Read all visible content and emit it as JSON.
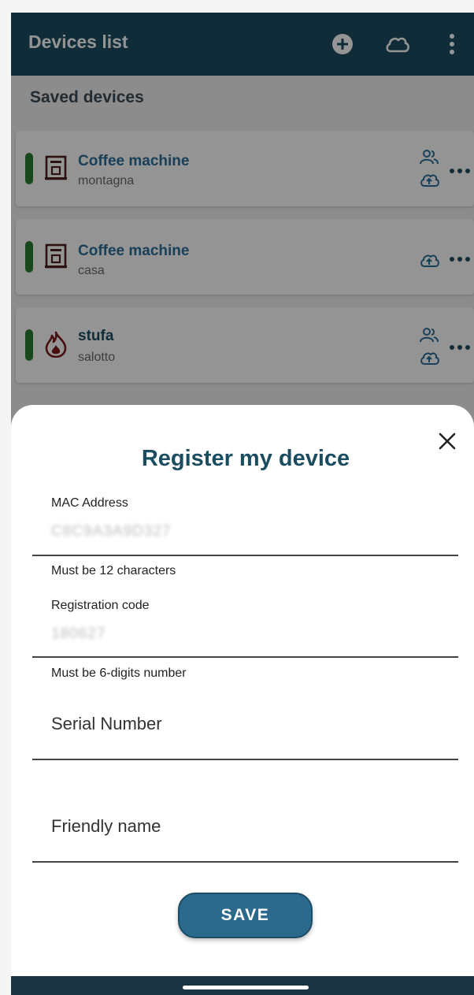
{
  "appbar": {
    "title": "Devices list",
    "icons": [
      "add-circle-icon",
      "cloud-icon",
      "more-vert-icon"
    ]
  },
  "saved_devices": {
    "heading": "Saved devices",
    "items": [
      {
        "name": "Coffee machine",
        "location": "montagna",
        "status_color": "#2e7d32",
        "device_icon": "coffee-machine-icon",
        "actions": [
          "users-icon",
          "cloud-upload-icon"
        ]
      },
      {
        "name": "Coffee machine",
        "location": "casa",
        "status_color": "#2e7d32",
        "device_icon": "coffee-machine-icon",
        "actions": [
          "cloud-upload-icon"
        ]
      },
      {
        "name": "stufa",
        "location": "salotto",
        "status_color": "#2e7d32",
        "device_icon": "flame-icon",
        "actions": [
          "users-icon",
          "cloud-upload-icon"
        ]
      }
    ]
  },
  "register_sheet": {
    "title": "Register my device",
    "mac": {
      "label": "MAC Address",
      "value": "C8C9A3A9D327",
      "helper": "Must be 12 characters"
    },
    "registration": {
      "label": "Registration code",
      "value": "180627",
      "helper": "Must be 6-digits number"
    },
    "serial": {
      "placeholder": "Serial Number"
    },
    "friendly": {
      "placeholder": "Friendly name"
    },
    "save_label": "SAVE"
  },
  "colors": {
    "primary": "#1b4d61",
    "accent": "#2a6f98",
    "button": "#2b6a8c",
    "status_ok": "#2e7d32"
  }
}
